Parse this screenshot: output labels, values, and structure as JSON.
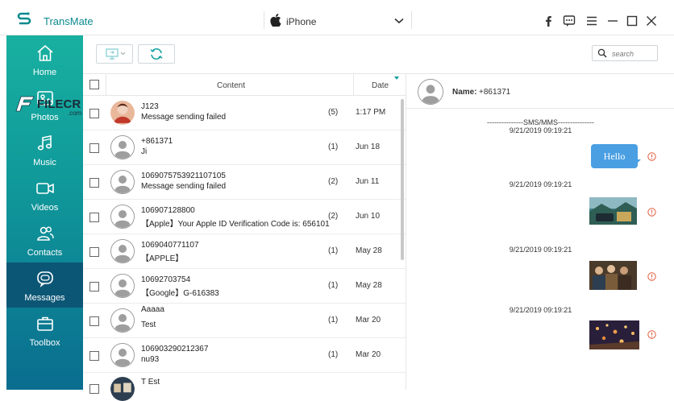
{
  "app": {
    "title": "TransMate"
  },
  "device": {
    "name": "iPhone"
  },
  "window_icons": [
    "facebook-icon",
    "feedback-icon",
    "menu-icon",
    "minimize-icon",
    "maximize-icon",
    "close-icon"
  ],
  "sidebar": {
    "items": [
      {
        "label": "Home",
        "icon": "home-icon",
        "active": false
      },
      {
        "label": "Photos",
        "icon": "photos-icon",
        "active": false
      },
      {
        "label": "Music",
        "icon": "music-icon",
        "active": false
      },
      {
        "label": "Videos",
        "icon": "videos-icon",
        "active": false
      },
      {
        "label": "Contacts",
        "icon": "contacts-icon",
        "active": false
      },
      {
        "label": "Messages",
        "icon": "messages-icon",
        "active": true
      },
      {
        "label": "Toolbox",
        "icon": "toolbox-icon",
        "active": false
      }
    ]
  },
  "watermark": {
    "text": "FILECR",
    "suffix": ".com"
  },
  "toolbar": {
    "search_placeholder": "search"
  },
  "list": {
    "headers": {
      "content": "Content",
      "date": "Date"
    },
    "rows": [
      {
        "name": "J123",
        "message": "Message sending failed",
        "count": "(5)",
        "date": "1:17 PM",
        "avatar": "photo"
      },
      {
        "name": "+861371",
        "message": "Ji",
        "count": "(1)",
        "date": "Jun 18",
        "avatar": "default"
      },
      {
        "name": "1069075753921107105",
        "message": "Message sending failed",
        "count": "(2)",
        "date": "Jun 11",
        "avatar": "default"
      },
      {
        "name": "106907128800",
        "message": "【Apple】Your Apple ID Verification Code is: 656101",
        "count": "(2)",
        "date": "Jun 10",
        "avatar": "default"
      },
      {
        "name": "1069040771107",
        "message": "【APPLE】",
        "count": "(1)",
        "date": "May 28",
        "avatar": "default"
      },
      {
        "name": "10692703754",
        "message": "【Google】G-616383",
        "count": "(1)",
        "date": "May 28",
        "avatar": "default"
      },
      {
        "name": "Aaaaa",
        "message": "Test",
        "count": "(1)",
        "date": "Mar 20",
        "avatar": "default"
      },
      {
        "name": "106903290212367",
        "message": "nu93",
        "count": "(1)",
        "date": "Mar 20",
        "avatar": "default"
      },
      {
        "name": "T Est",
        "message": "",
        "count": "",
        "date": "",
        "avatar": "photo2"
      }
    ]
  },
  "detail": {
    "name_label": "Name:",
    "name": "+861371",
    "conversation_title": "---------------SMS/MMS---------------",
    "messages": [
      {
        "timestamp": "9/21/2019 09:19:21",
        "type": "text",
        "text": "Hello"
      },
      {
        "timestamp": "9/21/2019 09:19:21",
        "type": "image",
        "image": "car-scene"
      },
      {
        "timestamp": "9/21/2019 09:19:21",
        "type": "image",
        "image": "people-scene"
      },
      {
        "timestamp": "9/21/2019 09:19:21",
        "type": "image",
        "image": "lanterns-scene"
      }
    ]
  },
  "colors": {
    "accent": "#10a0a0",
    "sidebar_active": "#0b5675",
    "bubble": "#4a9fe3",
    "warning": "#e05a3a"
  }
}
